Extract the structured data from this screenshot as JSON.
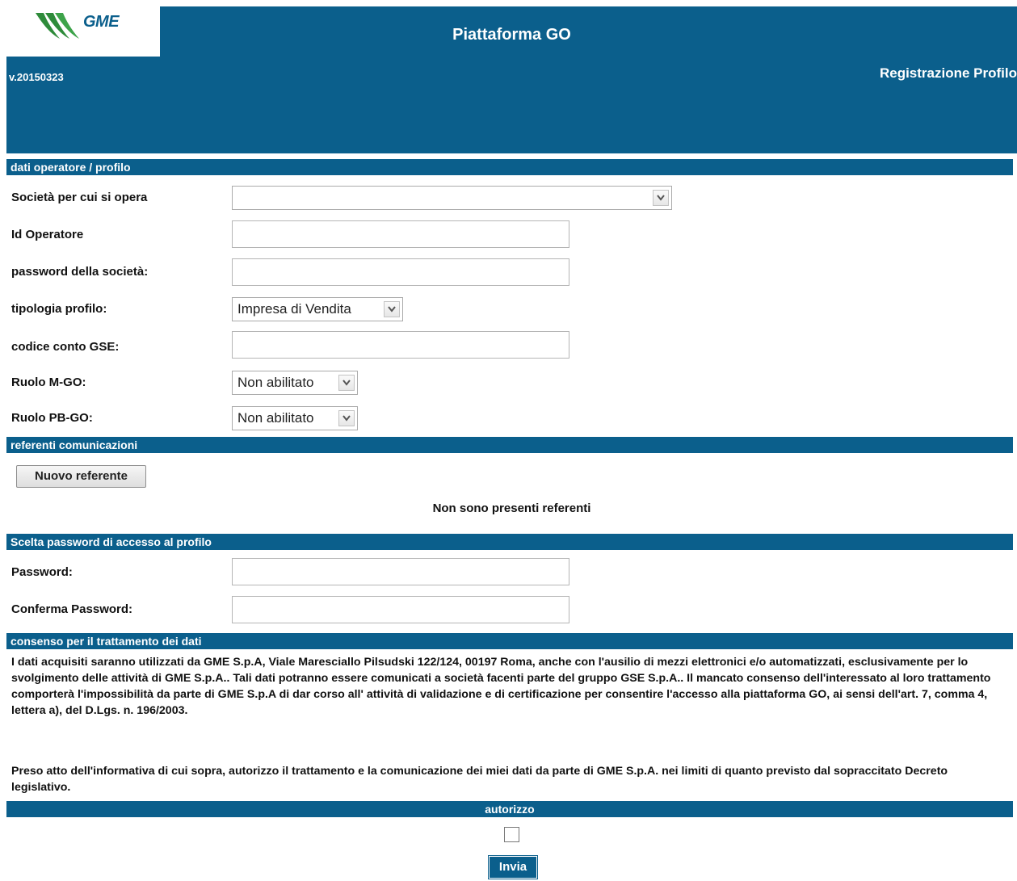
{
  "header": {
    "logo_text": "GME",
    "app_title": "Piattaforma GO",
    "version": "v.20150323",
    "section": "Registrazione Profilo"
  },
  "sections": {
    "operatore": "dati operatore / profilo",
    "referenti": "referenti comunicazioni",
    "password": "Scelta password di accesso al profilo",
    "consenso": "consenso per il trattamento dei dati",
    "autorizzo": "autorizzo"
  },
  "form": {
    "societa_label": "Società per cui si opera",
    "societa_value": "",
    "id_operatore_label": "Id Operatore",
    "id_operatore_value": "",
    "password_societa_label": "password della società:",
    "password_societa_value": "",
    "tipologia_label": "tipologia profilo:",
    "tipologia_value": "Impresa di Vendita",
    "codice_conto_label": "codice conto GSE:",
    "codice_conto_value": "",
    "ruolo_mgo_label": "Ruolo M-GO:",
    "ruolo_mgo_value": "Non abilitato",
    "ruolo_pbgo_label": "Ruolo PB-GO:",
    "ruolo_pbgo_value": "Non abilitato"
  },
  "referenti": {
    "new_button": "Nuovo referente",
    "empty_message": "Non sono presenti referenti"
  },
  "access_password": {
    "password_label": "Password:",
    "password_value": "",
    "confirm_label": "Conferma Password:",
    "confirm_value": ""
  },
  "consent": {
    "paragraph1": "I dati acquisiti saranno utilizzati da GME S.p.A, Viale Maresciallo Pilsudski 122/124, 00197 Roma, anche con l'ausilio di mezzi elettronici e/o automatizzati, esclusivamente per lo svolgimento delle attività di GME S.p.A.. Tali dati potranno essere comunicati a società facenti parte del gruppo GSE S.p.A.. Il mancato consenso dell'interessato al loro trattamento comporterà l'impossibilità da parte di GME S.p.A di dar corso all' attività di validazione e di certificazione per consentire l'accesso alla piattaforma GO, ai sensi dell'art. 7, comma 4, lettera a), del D.Lgs. n. 196/2003.",
    "paragraph2": "Preso atto dell'informativa di cui sopra, autorizzo il trattamento e la comunicazione dei miei dati da parte di GME S.p.A. nei limiti di quanto previsto dal sopraccitato Decreto legislativo.",
    "checked": false
  },
  "submit_label": "Invia",
  "colors": {
    "primary": "#0b5f8c",
    "logo_green": "#2e8b3a"
  }
}
